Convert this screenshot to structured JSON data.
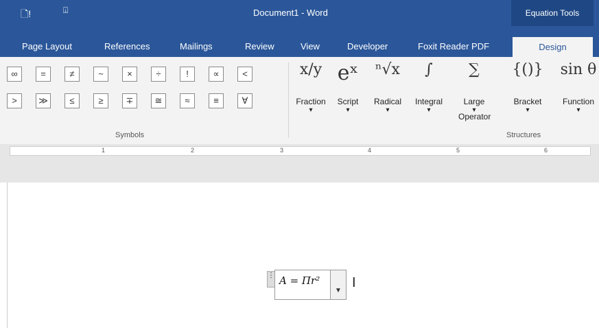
{
  "title_bar": {
    "title": "Document1 - Word",
    "equation_tools": "Equation Tools",
    "save_icon": "save-icon",
    "qat_icon": "customize-icon"
  },
  "tabs": [
    {
      "label": "Page Layout"
    },
    {
      "label": "References"
    },
    {
      "label": "Mailings"
    },
    {
      "label": "Review"
    },
    {
      "label": "View"
    },
    {
      "label": "Developer"
    },
    {
      "label": "Foxit Reader PDF"
    },
    {
      "label": "Design"
    }
  ],
  "symbols": {
    "row1": [
      "∞",
      "=",
      "≠",
      "~",
      "×",
      "÷",
      "!",
      "∝",
      "<"
    ],
    "row2": [
      ">",
      "≫",
      "≤",
      "≥",
      "∓",
      "≅",
      "≈",
      "≡",
      "∀"
    ],
    "label": "Symbols"
  },
  "structures": {
    "items": [
      {
        "glyph": "x/y",
        "label": "Fraction"
      },
      {
        "glyph": "eˣ",
        "label": "Script"
      },
      {
        "glyph": "ⁿ√x",
        "label": "Radical"
      },
      {
        "glyph": "∫",
        "label": "Integral"
      },
      {
        "glyph": "∑",
        "label": "Large"
      },
      {
        "glyph": "{()}",
        "label": "Bracket"
      },
      {
        "glyph": "sin θ",
        "label": "Function"
      }
    ],
    "large_label2": "Operator",
    "label": "Structures"
  },
  "ruler": {
    "marks": [
      "1",
      "2",
      "3",
      "4",
      "5",
      "6"
    ]
  },
  "document": {
    "equation": "A = Πr²"
  }
}
